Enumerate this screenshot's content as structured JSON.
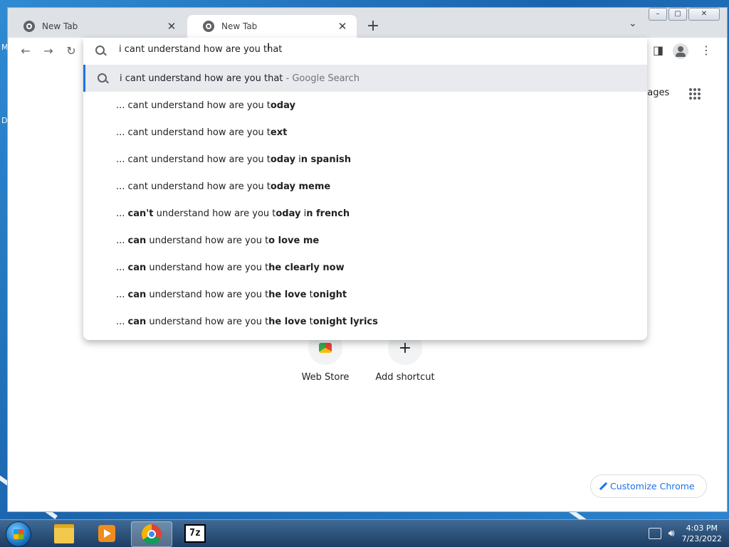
{
  "browser": {
    "tabs": [
      {
        "title": "New Tab"
      },
      {
        "title": "New Tab"
      }
    ],
    "window_controls": {
      "minimize": "–",
      "maximize": "▢",
      "close": "✕"
    },
    "omnibox": {
      "value": "i cant understand how are you that",
      "suggestions": [
        {
          "html": "i cant understand how are you that<span class=\"suffix\"> - Google Search</span>"
        },
        {
          "html": "... cant understand how are you t<b>oday</b>"
        },
        {
          "html": "... cant understand how are you t<b>ext</b>"
        },
        {
          "html": "... cant understand how are you t<b>oday</b> i<b>n spanish</b>"
        },
        {
          "html": "... cant understand how are you t<b>oday meme</b>"
        },
        {
          "html": "... <b>can't</b> understand how are you t<b>oday</b> i<b>n french</b>"
        },
        {
          "html": "... <b>can</b> understand how are you t<b>o love me</b>"
        },
        {
          "html": "... <b>can</b> understand how are you t<b>he clearly now</b>"
        },
        {
          "html": "... <b>can</b> understand how are you t<b>he love</b> t<b>onight</b>"
        },
        {
          "html": "... <b>can</b> understand how are you t<b>he love</b> t<b>onight lyrics</b>"
        }
      ]
    }
  },
  "newtab": {
    "images_link": "nages",
    "shortcuts": [
      {
        "label": "Web Store"
      },
      {
        "label": "Add shortcut"
      }
    ],
    "customize_label": "Customize Chrome"
  },
  "taskbar": {
    "time": "4:03 PM",
    "date": "7/23/2022",
    "zip_label": "7z"
  },
  "desktop": {
    "left_glyphs": [
      "M",
      "D"
    ]
  },
  "colors": {
    "accent": "#1a73e8",
    "taskbar": "#2b5480"
  }
}
